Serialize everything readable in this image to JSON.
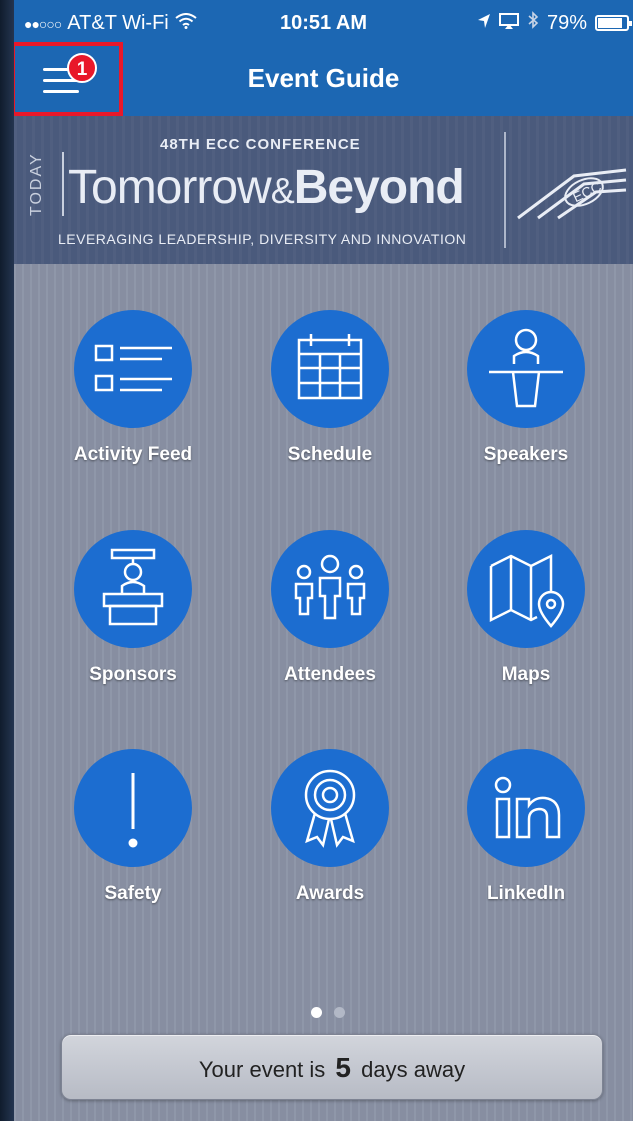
{
  "status_bar": {
    "signal": "●●○○○",
    "carrier": "AT&T Wi-Fi",
    "time": "10:51 AM",
    "battery_percent": "79%",
    "battery_level": 0.79
  },
  "nav": {
    "title": "Event Guide",
    "menu_badge": "1"
  },
  "banner": {
    "today": "TODAY",
    "conference": "48TH ECC CONFERENCE",
    "title_part1": "Tomorrow",
    "title_amp": "&",
    "title_part2": "Beyond",
    "tagline": "LEVERAGING LEADERSHIP, DIVERSITY AND INNOVATION"
  },
  "tiles": [
    {
      "label": "Activity Feed",
      "icon": "activity-feed-icon"
    },
    {
      "label": "Schedule",
      "icon": "calendar-icon"
    },
    {
      "label": "Speakers",
      "icon": "speaker-podium-icon"
    },
    {
      "label": "Sponsors",
      "icon": "sponsor-booth-icon"
    },
    {
      "label": "Attendees",
      "icon": "people-icon"
    },
    {
      "label": "Maps",
      "icon": "map-pin-icon"
    },
    {
      "label": "Safety",
      "icon": "exclamation-icon"
    },
    {
      "label": "Awards",
      "icon": "award-ribbon-icon"
    },
    {
      "label": "LinkedIn",
      "icon": "linkedin-icon"
    }
  ],
  "pager": {
    "pages": 2,
    "current": 1
  },
  "countdown": {
    "prefix": "Your event is",
    "days": "5",
    "suffix": "days away"
  },
  "colors": {
    "nav_blue": "#1c67b3",
    "tile_blue": "#1c6dd0",
    "highlight_red": "#e8182a",
    "background": "#8b93a6"
  }
}
